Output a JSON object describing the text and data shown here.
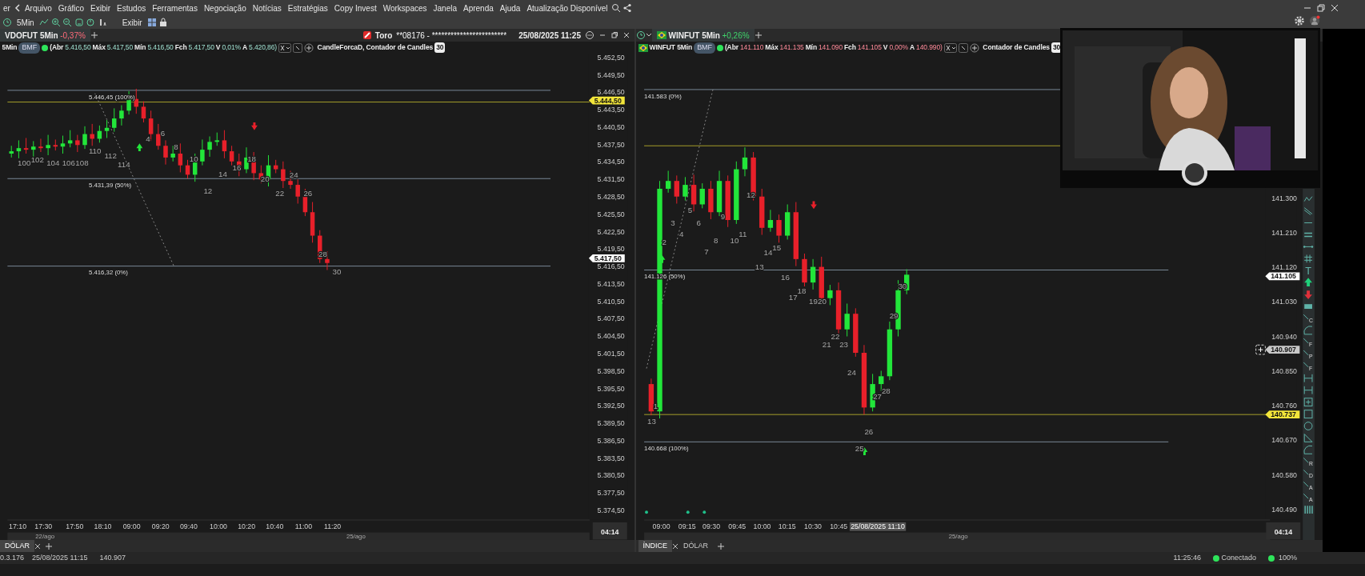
{
  "menu": [
    "er",
    "Arquivo",
    "Gráfico",
    "Exibir",
    "Estudos",
    "Ferramentas",
    "Negociação",
    "Notícias",
    "Estratégias",
    "Copy Invest",
    "Workspaces",
    "Janela",
    "Aprenda",
    "Ajuda",
    "Atualização Disponível"
  ],
  "toolbar": {
    "timeframe": "5Min",
    "view": "Exibir"
  },
  "panels": [
    {
      "tab": {
        "label": "VDOFUT 5Min",
        "change": "-0,37%"
      },
      "broker": {
        "name": "Toro",
        "account": "**08176 - ************************",
        "datetime": "25/08/2025 11:25"
      },
      "header": {
        "symbol": "5Min",
        "exchange": "BMF",
        "fields": [
          {
            "label": "(Abr",
            "value": "5.416,50"
          },
          {
            "label": "Máx",
            "value": "5.417,50"
          },
          {
            "label": "Mín",
            "value": "5.416,50"
          },
          {
            "label": "Fch",
            "value": "5.417,50"
          },
          {
            "label": "V",
            "value": "0,01%"
          },
          {
            "label": "A",
            "value": "5.420,86)"
          }
        ],
        "indicators": "CandleForcaD, Contador de Candles",
        "indicator_count": "30"
      },
      "price_ticks": [
        "5.452,50",
        "5.449,50",
        "5.446,50",
        "5.443,50",
        "5.440,50",
        "5.437,50",
        "5.434,50",
        "5.431,50",
        "5.428,50",
        "5.425,50",
        "5.422,50",
        "5.419,50",
        "5.416,50",
        "5.413,50",
        "5.410,50",
        "5.407,50",
        "5.404,50",
        "5.401,50",
        "5.398,50",
        "5.395,50",
        "5.392,50",
        "5.389,50",
        "5.386,50",
        "5.383,50",
        "5.380,50",
        "5.377,50",
        "5.374,50"
      ],
      "price_tags": [
        {
          "text": "5.444,50",
          "color": "#f2e53a"
        },
        {
          "text": "5.417,50",
          "color": "#ffffff"
        }
      ],
      "fib_levels": [
        "5.446,45 (100%)",
        "5.431,39 (50%)",
        "5.416,32 (0%)"
      ],
      "candle_labels": [
        "100",
        "102",
        "104",
        "106",
        "108",
        "110",
        "112",
        "114",
        "4",
        "6",
        "8",
        "10",
        "12",
        "14",
        "16",
        "18",
        "20",
        "22",
        "24",
        "26",
        "28",
        "30"
      ],
      "time_ticks": [
        "17:10",
        "17:30",
        "17:50",
        "18:10",
        "09:00",
        "09:20",
        "09:40",
        "10:00",
        "10:20",
        "10:40",
        "11:00",
        "11:20"
      ],
      "dates": [
        "22/ago",
        "25/ago"
      ],
      "corner_time": "04:14",
      "bottom_tabs": [
        {
          "label": "DÓLAR",
          "selected": true
        }
      ]
    },
    {
      "tab": {
        "label": "WINFUT 5Min",
        "change": "+0,26%"
      },
      "header": {
        "symbol": "WINFUT 5Min",
        "exchange": "BMF",
        "fields": [
          {
            "label": "(Abr",
            "value": "141.110"
          },
          {
            "label": "Máx",
            "value": "141.135"
          },
          {
            "label": "Mín",
            "value": "141.090"
          },
          {
            "label": "Fch",
            "value": "141.105"
          },
          {
            "label": "V",
            "value": "0,00%"
          },
          {
            "label": "A",
            "value": "140.990)"
          }
        ],
        "indicators": "Contador de Candles",
        "indicator_count": "30"
      },
      "price_ticks": [
        "141.300",
        "141.210",
        "141.120",
        "141.030",
        "140.940",
        "140.850",
        "140.760",
        "140.670",
        "140.580",
        "140.490"
      ],
      "price_tags": [
        {
          "text": "141.105",
          "color": "#ffffff"
        },
        {
          "text": "140.907",
          "color": "#c8c8c8"
        },
        {
          "text": "140.737",
          "color": "#f2e53a"
        }
      ],
      "fib_levels": [
        "141.583 (0%)",
        "141.126 (50%)",
        "140.668 (100%)"
      ],
      "candle_labels": [
        "13",
        "1",
        "2",
        "3",
        "4",
        "5",
        "6",
        "7",
        "8",
        "9",
        "10",
        "11",
        "12",
        "13",
        "14",
        "15",
        "16",
        "17",
        "18",
        "1920",
        "21",
        "22",
        "23",
        "24",
        "25",
        "26",
        "27",
        "28",
        "29",
        "30"
      ],
      "time_ticks": [
        "09:00",
        "09:15",
        "09:30",
        "09:45",
        "10:00",
        "10:15",
        "10:30",
        "10:45"
      ],
      "cursor_time": "25/08/2025 11:10",
      "dates": [
        "25/ago"
      ],
      "corner_time": "04:14",
      "tools": [
        {
          "kind": "zigzag"
        },
        {
          "kind": "diagonal"
        },
        {
          "kind": "hline"
        },
        {
          "kind": "double"
        },
        {
          "kind": "segment"
        },
        {
          "kind": "channel"
        },
        {
          "kind": "text",
          "letter": "T"
        },
        {
          "kind": "up"
        },
        {
          "kind": "down"
        },
        {
          "kind": "bar"
        },
        {
          "kind": "fib",
          "letter": "C"
        },
        {
          "kind": "arc"
        },
        {
          "kind": "fib",
          "letter": "F"
        },
        {
          "kind": "fib",
          "letter": "P"
        },
        {
          "kind": "fib",
          "letter": "F"
        },
        {
          "kind": "measure"
        },
        {
          "kind": "measure"
        },
        {
          "kind": "plus"
        },
        {
          "kind": "rect"
        },
        {
          "kind": "circle"
        },
        {
          "kind": "triangle"
        },
        {
          "kind": "arc"
        },
        {
          "kind": "fib",
          "letter": "R"
        },
        {
          "kind": "fib",
          "letter": "D"
        },
        {
          "kind": "fib",
          "letter": "A"
        },
        {
          "kind": "fib",
          "letter": "A"
        },
        {
          "kind": "bars"
        }
      ],
      "bottom_tabs": [
        {
          "label": "ÍNDICE",
          "selected": true
        },
        {
          "label": "DÓLAR",
          "selected": false
        }
      ]
    }
  ],
  "status_bar": {
    "version": "0.3.176",
    "datetime": "25/08/2025 11:15",
    "price": "140.907",
    "clock": "11:25:46",
    "connection": "Conectado",
    "connected": true,
    "zoom": "100%"
  }
}
